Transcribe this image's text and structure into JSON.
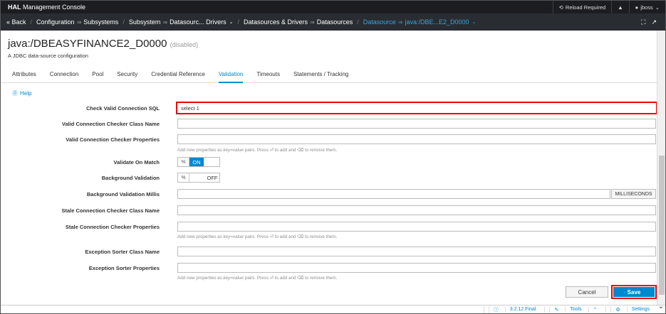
{
  "app": {
    "brand_bold": "HAL",
    "brand_rest": " Management Console"
  },
  "topbar": {
    "reload": "Reload Required",
    "user": "jboss"
  },
  "nav": {
    "back": "« Back",
    "items": [
      "Configuration",
      "Subsystems",
      "Subsystem",
      "Datasourc... Drivers",
      "Datasources & Drivers",
      "Datasources",
      "Datasource",
      "java:/DBE...E2_D0000"
    ]
  },
  "page": {
    "title": "java:/DBEASYFINANCE2_D0000",
    "status": "(disabled)",
    "description": "A JDBC data-source configuration"
  },
  "tabs": [
    "Attributes",
    "Connection",
    "Pool",
    "Security",
    "Credential Reference",
    "Validation",
    "Timeouts",
    "Statements / Tracking"
  ],
  "help": "Help",
  "form": {
    "check_sql_label": "Check Valid Connection SQL",
    "check_sql_value": "select 1",
    "checker_class_label": "Valid Connection Checker Class Name",
    "checker_props_label": "Valid Connection Checker Properties",
    "hint_prefix": "Add new properties as ",
    "hint_kv": "key=value",
    "hint_mid": " pairs. Press ",
    "hint_enter": "⏎",
    "hint_mid2": " to add and ",
    "hint_del": "⌫",
    "hint_suffix": " to remove them.",
    "validate_on_match_label": "Validate On Match",
    "on": "ON",
    "background_validation_label": "Background Validation",
    "off": "OFF",
    "bg_millis_label": "Background Validation Millis",
    "millis_unit": "MILLISECONDS",
    "stale_class_label": "Stale Connection Checker Class Name",
    "stale_props_label": "Stale Connection Checker Properties",
    "exc_class_label": "Exception Sorter Class Name",
    "exc_props_label": "Exception Sorter Properties"
  },
  "buttons": {
    "cancel": "Cancel",
    "save": "Save"
  },
  "footer": {
    "version": "3.2.12.Final",
    "tools": "Tools",
    "settings": "Settings"
  },
  "colors": {
    "accent": "#0088ce",
    "highlight": "#e00000",
    "topbar": "#1b1d21"
  }
}
